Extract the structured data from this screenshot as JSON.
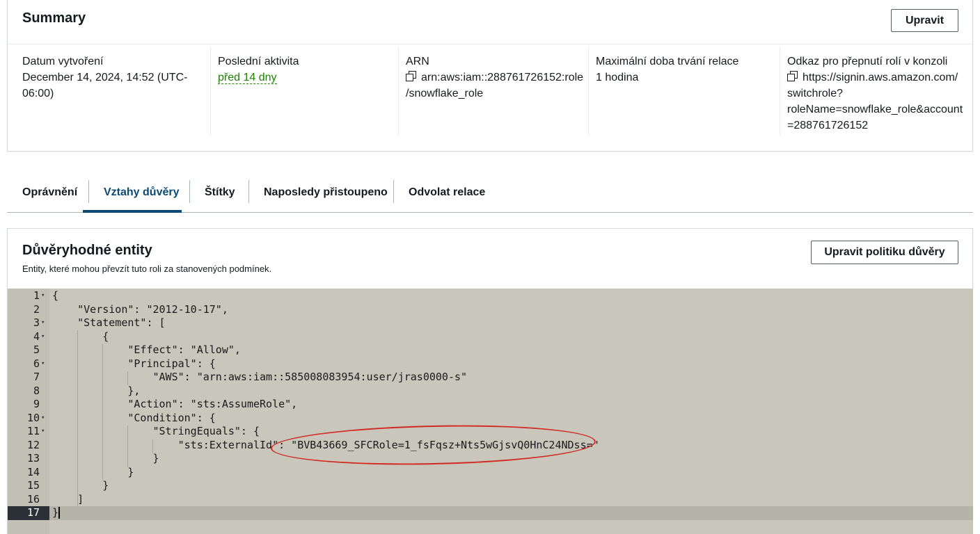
{
  "summary": {
    "title": "Summary",
    "edit_label": "Upravit",
    "created_label": "Datum vytvoření",
    "created_value_line1": "December 14, 2024, 14:52 (UTC-",
    "created_value_line2": "06:00)",
    "last_activity_label": "Poslední aktivita",
    "last_activity_value": "před 14 dny",
    "arn_label": "ARN",
    "arn_value_line1": "arn:aws:iam::288761726152:role",
    "arn_value_line2": "/snowflake_role",
    "max_session_label": "Maximální doba trvání relace",
    "max_session_value": "1 hodina",
    "switch_link_label": "Odkaz pro přepnutí rolí v konzoli",
    "switch_link_line1": "https://signin.aws.amazon.com/",
    "switch_link_line2": "switchrole?",
    "switch_link_line3": "roleName=snowflake_role&account",
    "switch_link_line4": "=288761726152"
  },
  "tabs": [
    {
      "label": "Oprávnění"
    },
    {
      "label": "Vztahy důvěry"
    },
    {
      "label": "Štítky"
    },
    {
      "label": "Naposledy přistoupeno"
    },
    {
      "label": "Odvolat relace"
    }
  ],
  "active_tab": "Vztahy důvěry",
  "trust": {
    "title": "Důvěryhodné entity",
    "description": "Entity, které mohou převzít tuto roli za stanovených podmínek.",
    "edit_policy_label": "Upravit politiku důvěry"
  },
  "policy_lines": [
    {
      "n": "1",
      "fold": true,
      "text": "{"
    },
    {
      "n": "2",
      "fold": false,
      "text": "    \"Version\": \"2012-10-17\","
    },
    {
      "n": "3",
      "fold": true,
      "text": "    \"Statement\": ["
    },
    {
      "n": "4",
      "fold": true,
      "text": "        {"
    },
    {
      "n": "5",
      "fold": false,
      "text": "            \"Effect\": \"Allow\","
    },
    {
      "n": "6",
      "fold": true,
      "text": "            \"Principal\": {"
    },
    {
      "n": "7",
      "fold": false,
      "text": "                \"AWS\": \"arn:aws:iam::585008083954:user/jras0000-s\""
    },
    {
      "n": "8",
      "fold": false,
      "text": "            },"
    },
    {
      "n": "9",
      "fold": false,
      "text": "            \"Action\": \"sts:AssumeRole\","
    },
    {
      "n": "10",
      "fold": true,
      "text": "            \"Condition\": {"
    },
    {
      "n": "11",
      "fold": true,
      "text": "                \"StringEquals\": {"
    },
    {
      "n": "12",
      "fold": false,
      "text": "                    \"sts:ExternalId\": \"BVB43669_SFCRole=1_fsFqsz+Nts5wGjsvQ0HnC24NDss=\""
    },
    {
      "n": "13",
      "fold": false,
      "text": "                }"
    },
    {
      "n": "14",
      "fold": false,
      "text": "            }"
    },
    {
      "n": "15",
      "fold": false,
      "text": "        }"
    },
    {
      "n": "16",
      "fold": false,
      "text": "    ]"
    },
    {
      "n": "17",
      "fold": false,
      "text": "}"
    }
  ],
  "current_line": "17",
  "colors": {
    "accent": "#0b4a75",
    "activity_green": "#1d8102",
    "highlight_red": "#d22a22",
    "editor_bg": "#c9c7bb"
  }
}
